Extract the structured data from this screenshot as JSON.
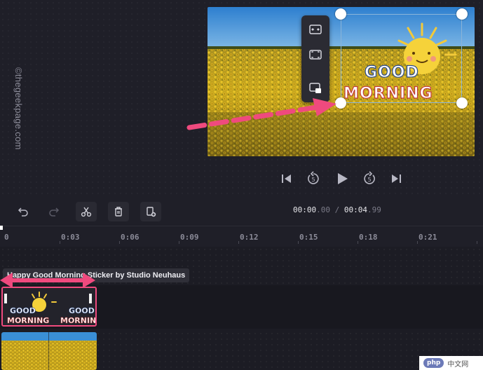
{
  "watermark": "©thegeekpage.com",
  "sticker": {
    "line1": "GOOD",
    "line2": "MORNING"
  },
  "floating_toolbar": {
    "items": [
      "fit-icon",
      "fill-icon",
      "picture-in-picture-icon"
    ]
  },
  "playback": {
    "items": [
      "skip-back-icon",
      "rewind-5-icon",
      "play-icon",
      "forward-5-icon",
      "skip-forward-icon"
    ],
    "skip_label": "5"
  },
  "toolbar": {
    "items": [
      "undo-icon",
      "redo-icon",
      "split-icon",
      "delete-icon",
      "duplicate-icon"
    ]
  },
  "timecode": {
    "current_main": "00:00",
    "current_frac": ".00",
    "separator": "/",
    "total_main": "00:04",
    "total_frac": ".99"
  },
  "ruler": {
    "ticks": [
      "0",
      "0:03",
      "0:06",
      "0:09",
      "0:12",
      "0:15",
      "0:18",
      "0:21"
    ]
  },
  "clip": {
    "label": "Happy Good Morning Sticker by Studio Neuhaus"
  },
  "badge": {
    "logo": "php",
    "text": "中文网"
  },
  "colors": {
    "background": "#1f1f28",
    "accent": "#ef4a7e",
    "sky": "#3a8fd6",
    "sunflower": "#d9b51e",
    "sun": "#f5d23a"
  }
}
